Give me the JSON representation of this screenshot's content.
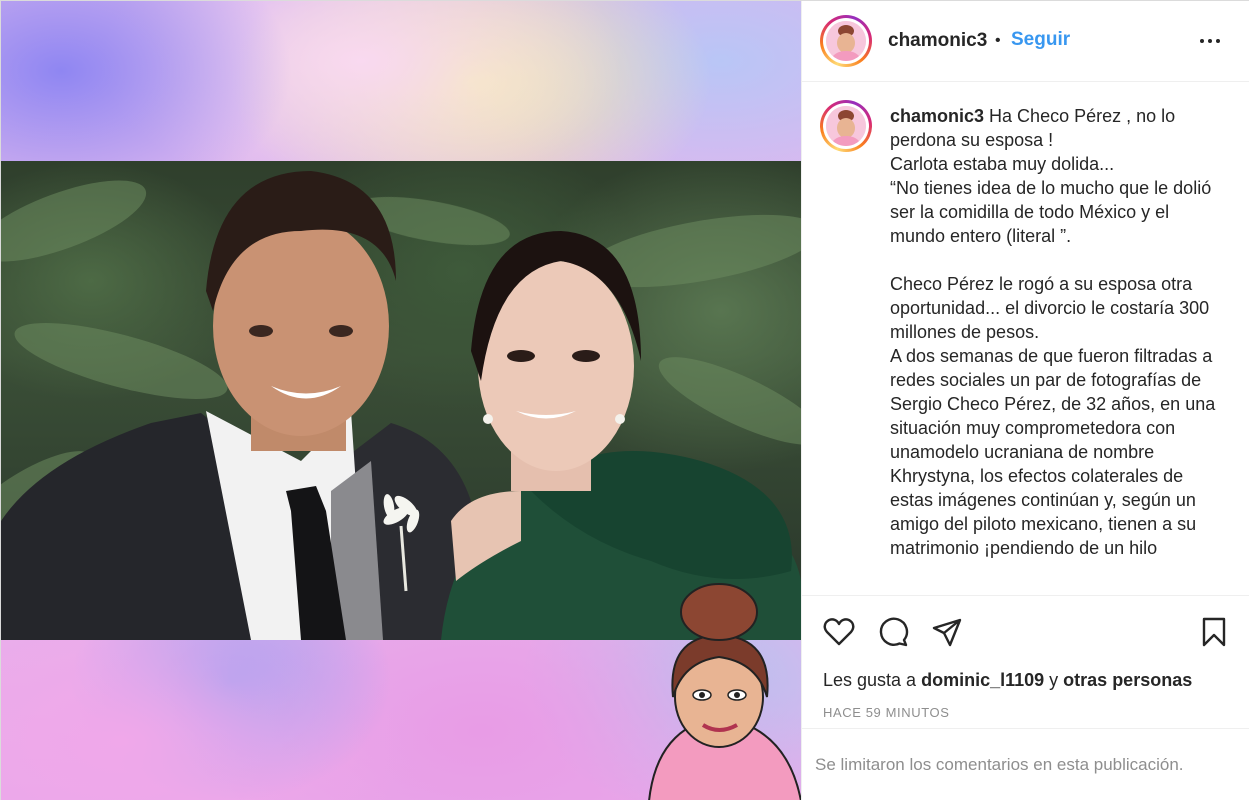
{
  "post": {
    "username": "chamonic3",
    "separator": "•",
    "follow_label": "Seguir",
    "more_label": "more-options",
    "caption_user": "chamonic3",
    "caption_text": " Ha Checo Pérez , no lo perdona su esposa !\nCarlota estaba muy dolida...\n“No tienes idea de lo mucho que le dolió ser la comidilla de todo México y el mundo entero (literal ”.\n\nCheco Pérez le rogó a su esposa otra oportunidad... el divorcio le costaría 300 millones de pesos.\nA dos semanas de que fueron filtradas a redes sociales un par de fotografías de Sergio Checo Pérez, de 32 años, en una situación muy comprometedora con unamodelo ucraniana de nombre Khrystyna, los efectos colaterales de estas imágenes continúan y, según un amigo del piloto mexicano, tienen a su matrimonio ¡pendiendo de un hilo"
  },
  "actions": {
    "like_icon": "heart-icon",
    "comment_icon": "comment-icon",
    "share_icon": "share-icon",
    "save_icon": "bookmark-icon"
  },
  "likes": {
    "prefix": "Les gusta a ",
    "user": "dominic_l1109",
    "middle": " y ",
    "others": "otras personas"
  },
  "timestamp": "HACE 59 MINUTOS",
  "comments_notice": "Se limitaron los comentarios en esta publicación.",
  "colors": {
    "follow": "#3897f0",
    "text": "#262626",
    "muted": "#8e8e8e",
    "border": "#efefef"
  }
}
